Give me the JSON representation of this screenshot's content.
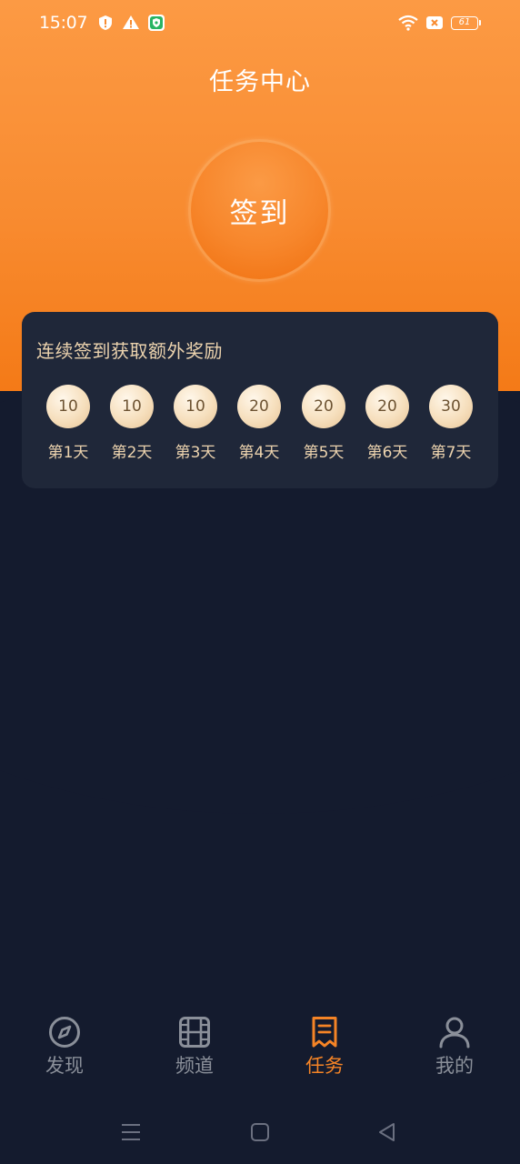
{
  "status_bar": {
    "time": "15:07",
    "battery": "61"
  },
  "header": {
    "title": "任务中心",
    "signin_label": "签到"
  },
  "reward": {
    "title": "连续签到获取额外奖励",
    "days": [
      {
        "coins": "10",
        "label": "第1天"
      },
      {
        "coins": "10",
        "label": "第2天"
      },
      {
        "coins": "10",
        "label": "第3天"
      },
      {
        "coins": "20",
        "label": "第4天"
      },
      {
        "coins": "20",
        "label": "第5天"
      },
      {
        "coins": "20",
        "label": "第6天"
      },
      {
        "coins": "30",
        "label": "第7天"
      }
    ]
  },
  "nav": {
    "items": [
      {
        "label": "发现",
        "icon": "compass-icon"
      },
      {
        "label": "频道",
        "icon": "film-icon"
      },
      {
        "label": "任务",
        "icon": "task-icon",
        "active": true
      },
      {
        "label": "我的",
        "icon": "user-icon"
      }
    ]
  },
  "colors": {
    "accent": "#f58426",
    "background": "#141b2e",
    "card": "#1f2739",
    "gold_text": "#ecd3ae",
    "inactive": "#8a8f99"
  }
}
